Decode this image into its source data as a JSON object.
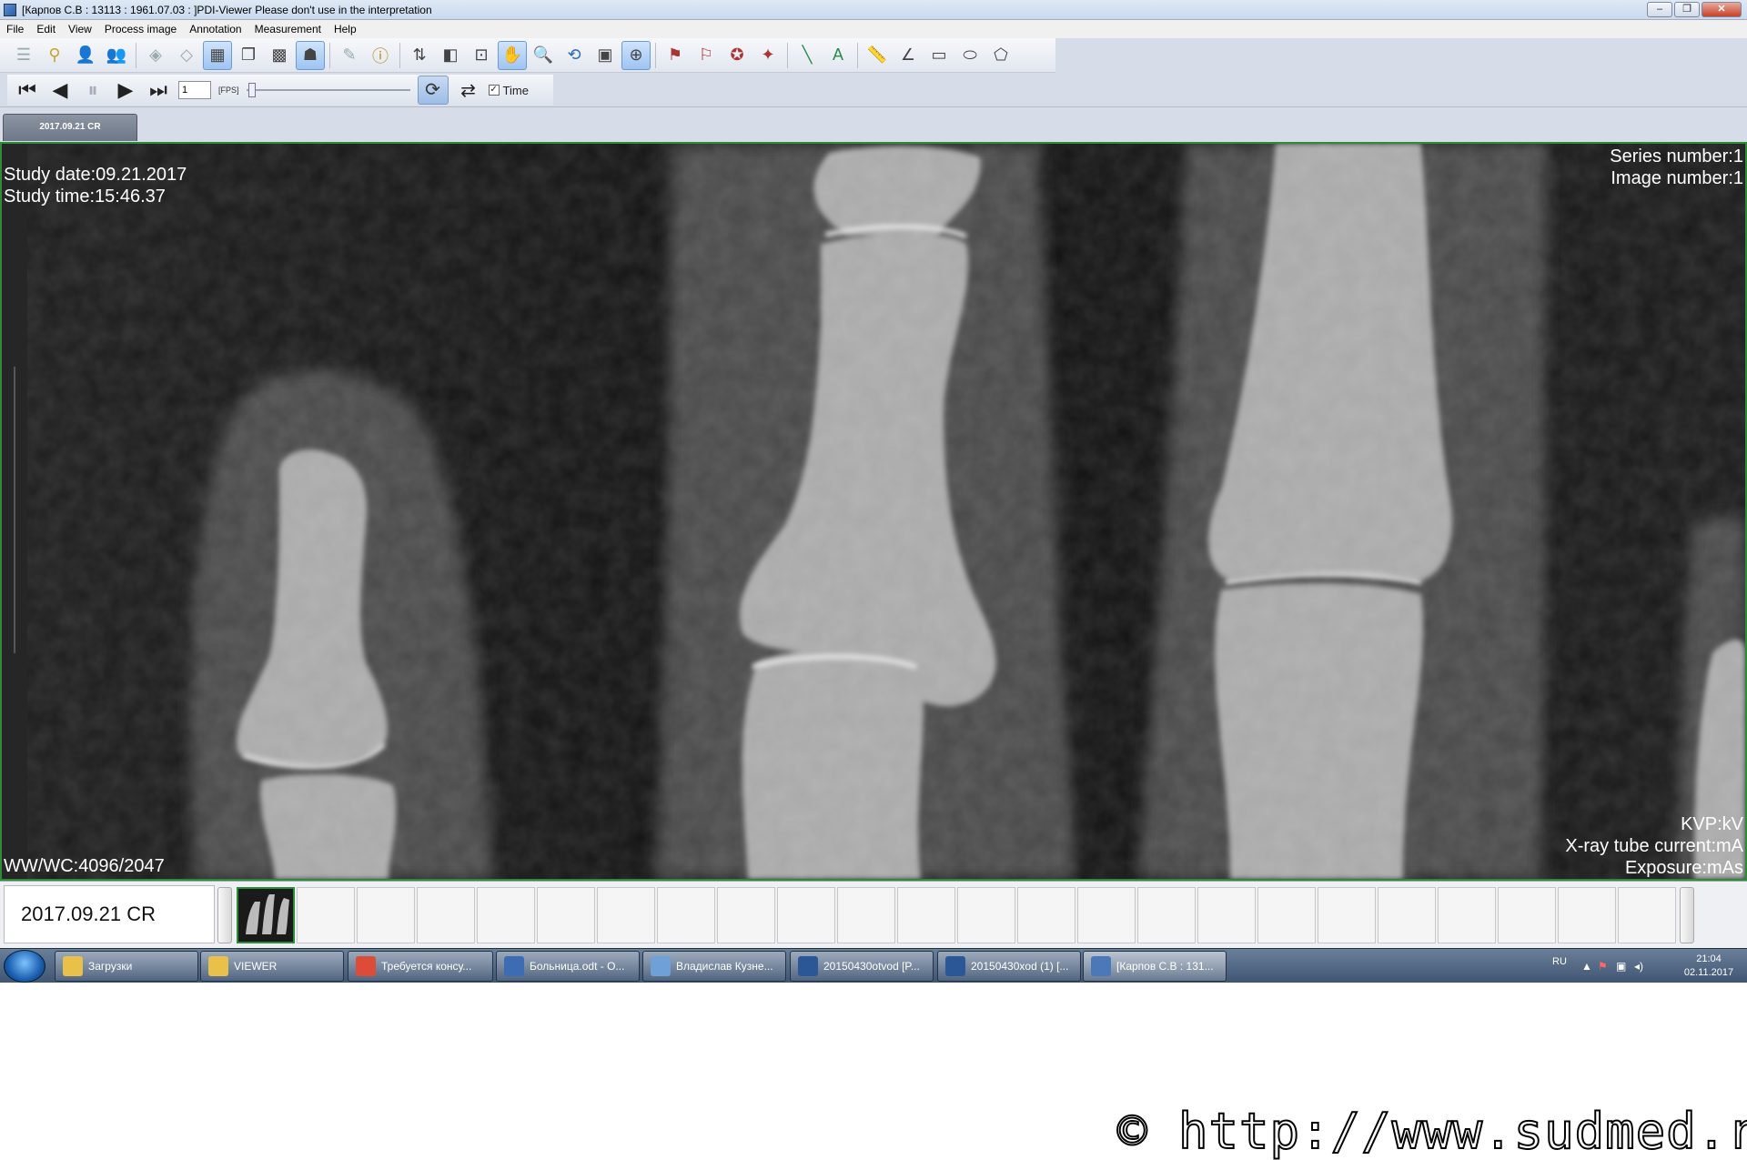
{
  "window": {
    "title": "[Карпов С.В : 13113 : 1961.07.03 : ]PDI-Viewer  Please don't use in the interpretation",
    "buttons": [
      "–",
      "❐",
      "✕"
    ]
  },
  "menu": [
    "File",
    "Edit",
    "View",
    "Process image",
    "Annotation",
    "Measurement",
    "Help"
  ],
  "toolbar": {
    "icons": [
      "list-icon",
      "link-icon",
      "patient-icon",
      "patient-export-icon",
      "layers-icon",
      "layers-alt-icon",
      "grid-icon",
      "copy-icon",
      "grid-alt-icon",
      "person-icon",
      "edit-icon",
      "info-icon",
      "flip-icon",
      "invert-icon",
      "window-level-icon",
      "pan-icon",
      "zoom-icon",
      "rotate-icon",
      "frame-icon",
      "magnify-icon",
      "annotation-1-icon",
      "annotation-2-icon",
      "annotation-3-icon",
      "annotation-4-icon",
      "line-icon",
      "text-icon",
      "ruler-icon",
      "angle-icon",
      "rect-icon",
      "ellipse-icon",
      "polygon-icon"
    ]
  },
  "playback": {
    "frame": "1",
    "fps_label": "[FPS]",
    "time_label": "Time",
    "time_checked": true
  },
  "tab": {
    "label": "2017.09.21 CR"
  },
  "overlay": {
    "study_date": "Study date:09.21.2017",
    "study_time": "Study time:15:46.37",
    "series_number": "Series number:1",
    "image_number": "Image number:1",
    "wwwc": "WW/WC:4096/2047",
    "kvp": "KVP:kV",
    "tube_current": "X-ray tube current:mA",
    "exposure": "Exposure:mAs"
  },
  "thumbnails": {
    "series_label": "2017.09.21 CR",
    "count": 24,
    "selected_index": 0
  },
  "taskbar": {
    "items": [
      {
        "label": "Загрузки",
        "icon": "folder-icon",
        "color": "#e8c04a"
      },
      {
        "label": "VIEWER",
        "icon": "folder-icon",
        "color": "#e8c04a"
      },
      {
        "label": "Требуется консу...",
        "icon": "chrome-icon",
        "color": "#dd4b39"
      },
      {
        "label": "Больница.odt - O...",
        "icon": "writer-icon",
        "color": "#3d6cb5"
      },
      {
        "label": "Владислав Кузне...",
        "icon": "document-icon",
        "color": "#6fa0d8"
      },
      {
        "label": "20150430otvod [P...",
        "icon": "word-icon",
        "color": "#2b5797"
      },
      {
        "label": "20150430xod (1) [...",
        "icon": "word-icon",
        "color": "#2b5797"
      },
      {
        "label": "[Карпов С.В : 131...",
        "icon": "viewer-icon",
        "color": "#4a78b8"
      }
    ],
    "lang": "RU",
    "time": "21:04",
    "date": "02.11.2017"
  },
  "watermark": "© http://www.sudmed.ru",
  "colors": {
    "frame_border": "#2e8b3a",
    "viewport_bg": "#0d0d0d",
    "overlay_text": "#ffffff"
  }
}
